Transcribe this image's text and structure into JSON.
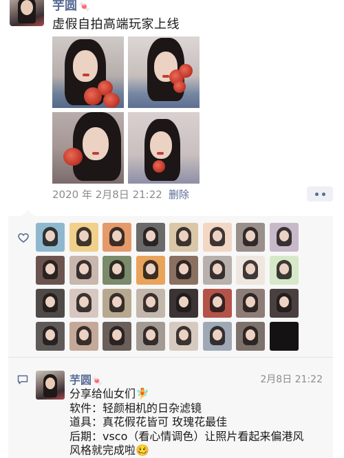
{
  "post": {
    "author": "芋圆",
    "author_deco": "🍬",
    "text": "虚假自拍高端玩家上线",
    "time": "2020 年 2月8日 21:22",
    "delete_label": "删除"
  },
  "comment": {
    "author": "芋圆",
    "author_deco": "🍬",
    "time": "2月8日 21:22",
    "lines": [
      "分享给仙女们🧚",
      "软件：轻颜相机的日杂滤镜",
      "道具：真花假花皆可 玫瑰花最佳",
      "后期：vsco（看心情调色）让照片看起来偏港风",
      "风格就完成啦🥴"
    ]
  },
  "likes": {
    "count": 32,
    "colors": [
      "#8fb8cf",
      "#f0d08a",
      "#e49a6a",
      "#6a6a6a",
      "#d9c7a8",
      "#f2d7c4",
      "#9a8f8a",
      "#c8b9c9",
      "#6b5450",
      "#c9b7ad",
      "#7a8a6a",
      "#e9a35a",
      "#8a7060",
      "#b8b0ad",
      "#efe6e0",
      "#d6e8c8",
      "#4f4a48",
      "#d8c6c0",
      "#b7a890",
      "#c2b7aa",
      "#3a3434",
      "#b4534a",
      "#8e7c76",
      "#4a4040",
      "#5f5a58",
      "#c4a898",
      "#6a5f5a",
      "#a39b93",
      "#d6c9c0",
      "#9fa9b5",
      "#7d716c",
      "#141212"
    ]
  }
}
